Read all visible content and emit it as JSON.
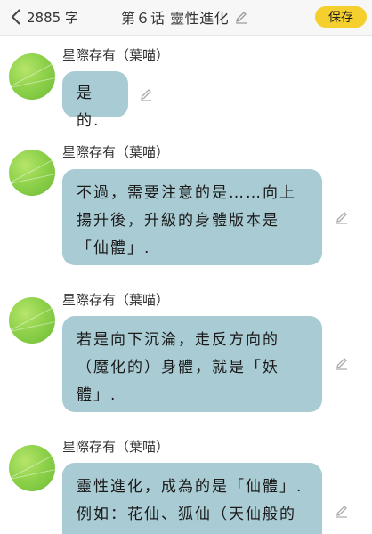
{
  "header": {
    "word_count": "2885 字",
    "chapter_title": "第６话 靈性進化",
    "save_label": "保存"
  },
  "messages": [
    {
      "sender": "星際存有（葉喵）",
      "text": "是的."
    },
    {
      "sender": "星際存有（葉喵）",
      "text": "不過，需要注意的是……向上\n揚升後，升級的身體版本是\n「仙體」."
    },
    {
      "sender": "星際存有（葉喵）",
      "text": "若是向下沉淪，走反方向的\n（魔化的）身體，就是「妖\n體」."
    },
    {
      "sender": "星際存有（葉喵）",
      "text": "靈性進化，成為的是「仙體」.\n例如：花仙、狐仙（天仙般的"
    }
  ],
  "colors": {
    "accent": "#f5cf2e",
    "bubble": "#a9cbd3"
  },
  "icons": {
    "back": "chevron-left-icon",
    "edit": "pencil-icon",
    "avatar": "green-leaf-avatar"
  }
}
